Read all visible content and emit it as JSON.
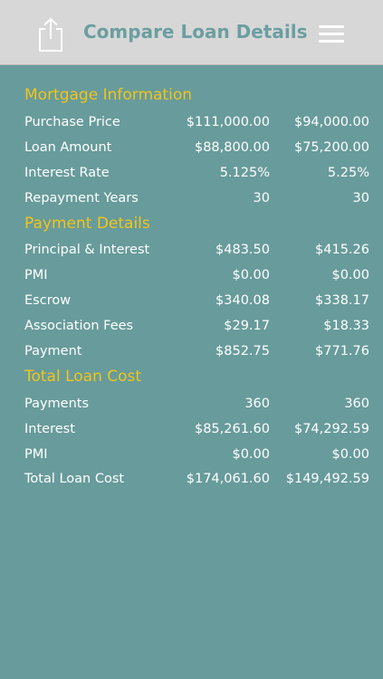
{
  "header": {
    "title": "Compare Loan Details",
    "share_icon": "share-icon",
    "menu_icon": "hamburger-menu-icon"
  },
  "colors": {
    "background": "#689b9b",
    "header_background": "#d7d7d7",
    "title": "#6c9ea1",
    "section_title": "#f0c51c",
    "text": "#ffffff"
  },
  "sections": {
    "mortgage": {
      "title": "Mortgage Information",
      "rows": [
        {
          "label": "Purchase Price",
          "v1": "$111,000.00",
          "v2": "$94,000.00"
        },
        {
          "label": "Loan Amount",
          "v1": "$88,800.00",
          "v2": "$75,200.00"
        },
        {
          "label": "Interest Rate",
          "v1": "5.125%",
          "v2": "5.25%"
        },
        {
          "label": "Repayment Years",
          "v1": "30",
          "v2": "30"
        }
      ]
    },
    "payment": {
      "title": "Payment Details",
      "rows": [
        {
          "label": "Principal & Interest",
          "v1": "$483.50",
          "v2": "$415.26"
        },
        {
          "label": "PMI",
          "v1": "$0.00",
          "v2": "$0.00"
        },
        {
          "label": "Escrow",
          "v1": "$340.08",
          "v2": "$338.17"
        },
        {
          "label": "Association Fees",
          "v1": "$29.17",
          "v2": "$18.33"
        },
        {
          "label": "Payment",
          "v1": "$852.75",
          "v2": "$771.76"
        }
      ]
    },
    "total": {
      "title": "Total Loan Cost",
      "rows": [
        {
          "label": "Payments",
          "v1": "360",
          "v2": "360"
        },
        {
          "label": "Interest",
          "v1": "$85,261.60",
          "v2": "$74,292.59"
        },
        {
          "label": "PMI",
          "v1": "$0.00",
          "v2": "$0.00"
        },
        {
          "label": "Total Loan Cost",
          "v1": "$174,061.60",
          "v2": "$149,492.59"
        }
      ]
    }
  }
}
